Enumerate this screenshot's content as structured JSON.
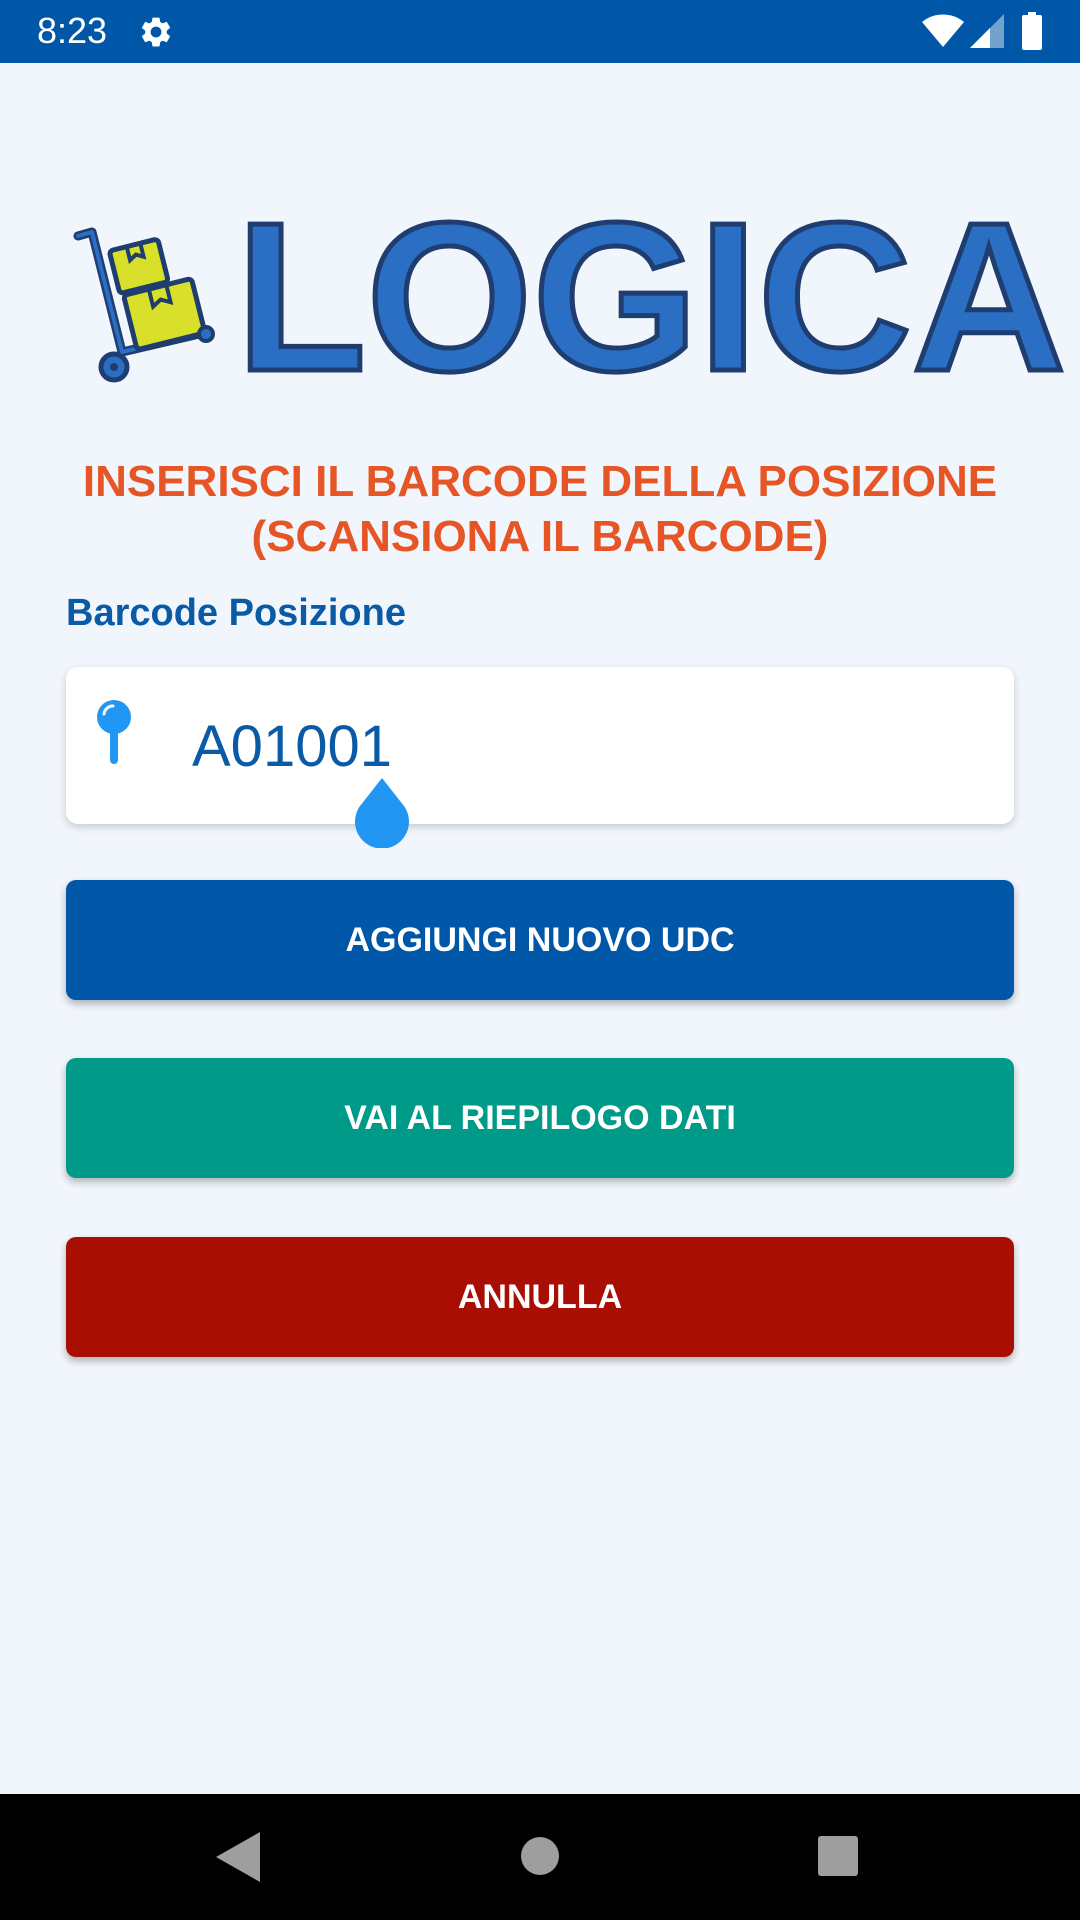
{
  "status_bar": {
    "time": "8:23",
    "icons": [
      "gear-icon",
      "wifi-icon",
      "cell-signal-icon",
      "battery-icon"
    ]
  },
  "logo": {
    "text": "LOGICA",
    "icon": "hand-truck-with-boxes"
  },
  "instruction": {
    "line1": "INSERISCI IL BARCODE DELLA POSIZIONE",
    "line2": "(SCANSIONA IL BARCODE)"
  },
  "field": {
    "label": "Barcode Posizione",
    "value": "A01001",
    "icon": "location-pin-icon"
  },
  "buttons": {
    "add": "AGGIUNGI NUOVO UDC",
    "summary": "VAI AL RIEPILOGO DATI",
    "cancel": "ANNULLA"
  },
  "nav_bar": {
    "icons": [
      "back-icon",
      "home-icon",
      "recents-icon"
    ]
  },
  "colors": {
    "primary": "#0057a8",
    "accent_orange": "#e55525",
    "teal": "#009a88",
    "red": "#a90e02",
    "background": "#f1f6fc",
    "logo_yellow": "#d8e02a"
  }
}
